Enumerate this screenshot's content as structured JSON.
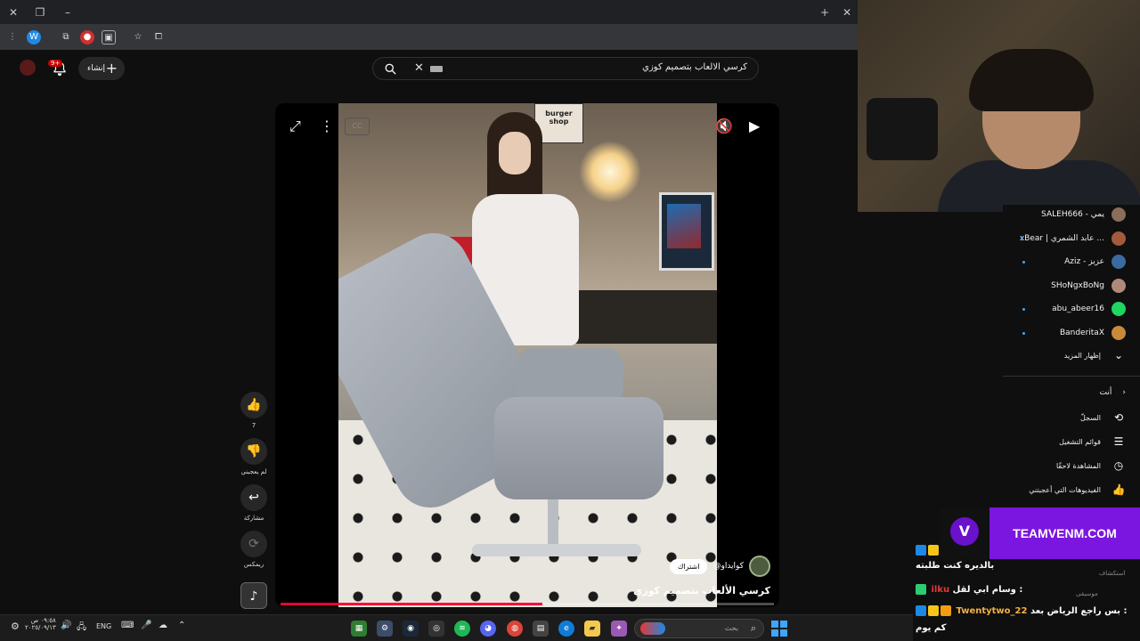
{
  "browser": {
    "close_tab_icon": "close-icon",
    "new_tab_label": "+",
    "window_close": "✕",
    "window_minimize": "–"
  },
  "header": {
    "search_query": "كرسي الالعاب بتصميم كوزي",
    "create_label": "إنشاء",
    "notification_count": "9+"
  },
  "video": {
    "channel": "@كوايداو",
    "subscribe_label": "اشتراك",
    "title": "كرسي الألعاب بتصميم كوزي",
    "sign_text": "burger shop",
    "progress": 0.53
  },
  "actions": {
    "likes": "7",
    "dislike_label": "لم يعجبني",
    "share_label": "مشاركة",
    "remix_label": "ريمكس"
  },
  "sidebar": {
    "subscriptions": [
      {
        "name": "SALEH666 - يمي",
        "dot": false,
        "color": "#8a6d5b"
      },
      {
        "name": "xBear | عابد الشمري ...",
        "dot": true,
        "color": "#a35a3a"
      },
      {
        "name": "Aziz - عزيز",
        "dot": true,
        "color": "#3a6aa0"
      },
      {
        "name": "SHoNgxBoNg",
        "dot": false,
        "color": "#b0897a"
      },
      {
        "name": "abu_abeer16",
        "dot": true,
        "color": "#1ed760"
      },
      {
        "name": "BanderitaX",
        "dot": true,
        "color": "#c88a3a"
      }
    ],
    "show_more": "إظهار المزيد",
    "you_section": "أنت",
    "menu": [
      {
        "label": "السجلّ",
        "icon": "⟲"
      },
      {
        "label": "قوائم التشغيل",
        "icon": "☰"
      },
      {
        "label": "المشاهدة لاحقًا",
        "icon": "◷"
      },
      {
        "label": "الفيديوهات التي أعجبتني",
        "icon": "👍"
      }
    ],
    "explore": "استكشاف",
    "music": "موسيقى"
  },
  "stream": {
    "brand": "TEAMVENM.COM",
    "chat": [
      {
        "user": "",
        "message": "بالديره كنت طلبته"
      },
      {
        "user": "ilku",
        "message": "وسام ابي لقل :"
      },
      {
        "user": "Twentytwo_22",
        "message": "بس راجع الرياض بعد :"
      },
      {
        "user": "",
        "message": "كم يوم"
      }
    ]
  },
  "taskbar": {
    "search_placeholder": "بحث",
    "language": "ENG",
    "time": "٠٩:٥٨ ص",
    "date": "٢٠٢٥/٠٩/١٣"
  }
}
